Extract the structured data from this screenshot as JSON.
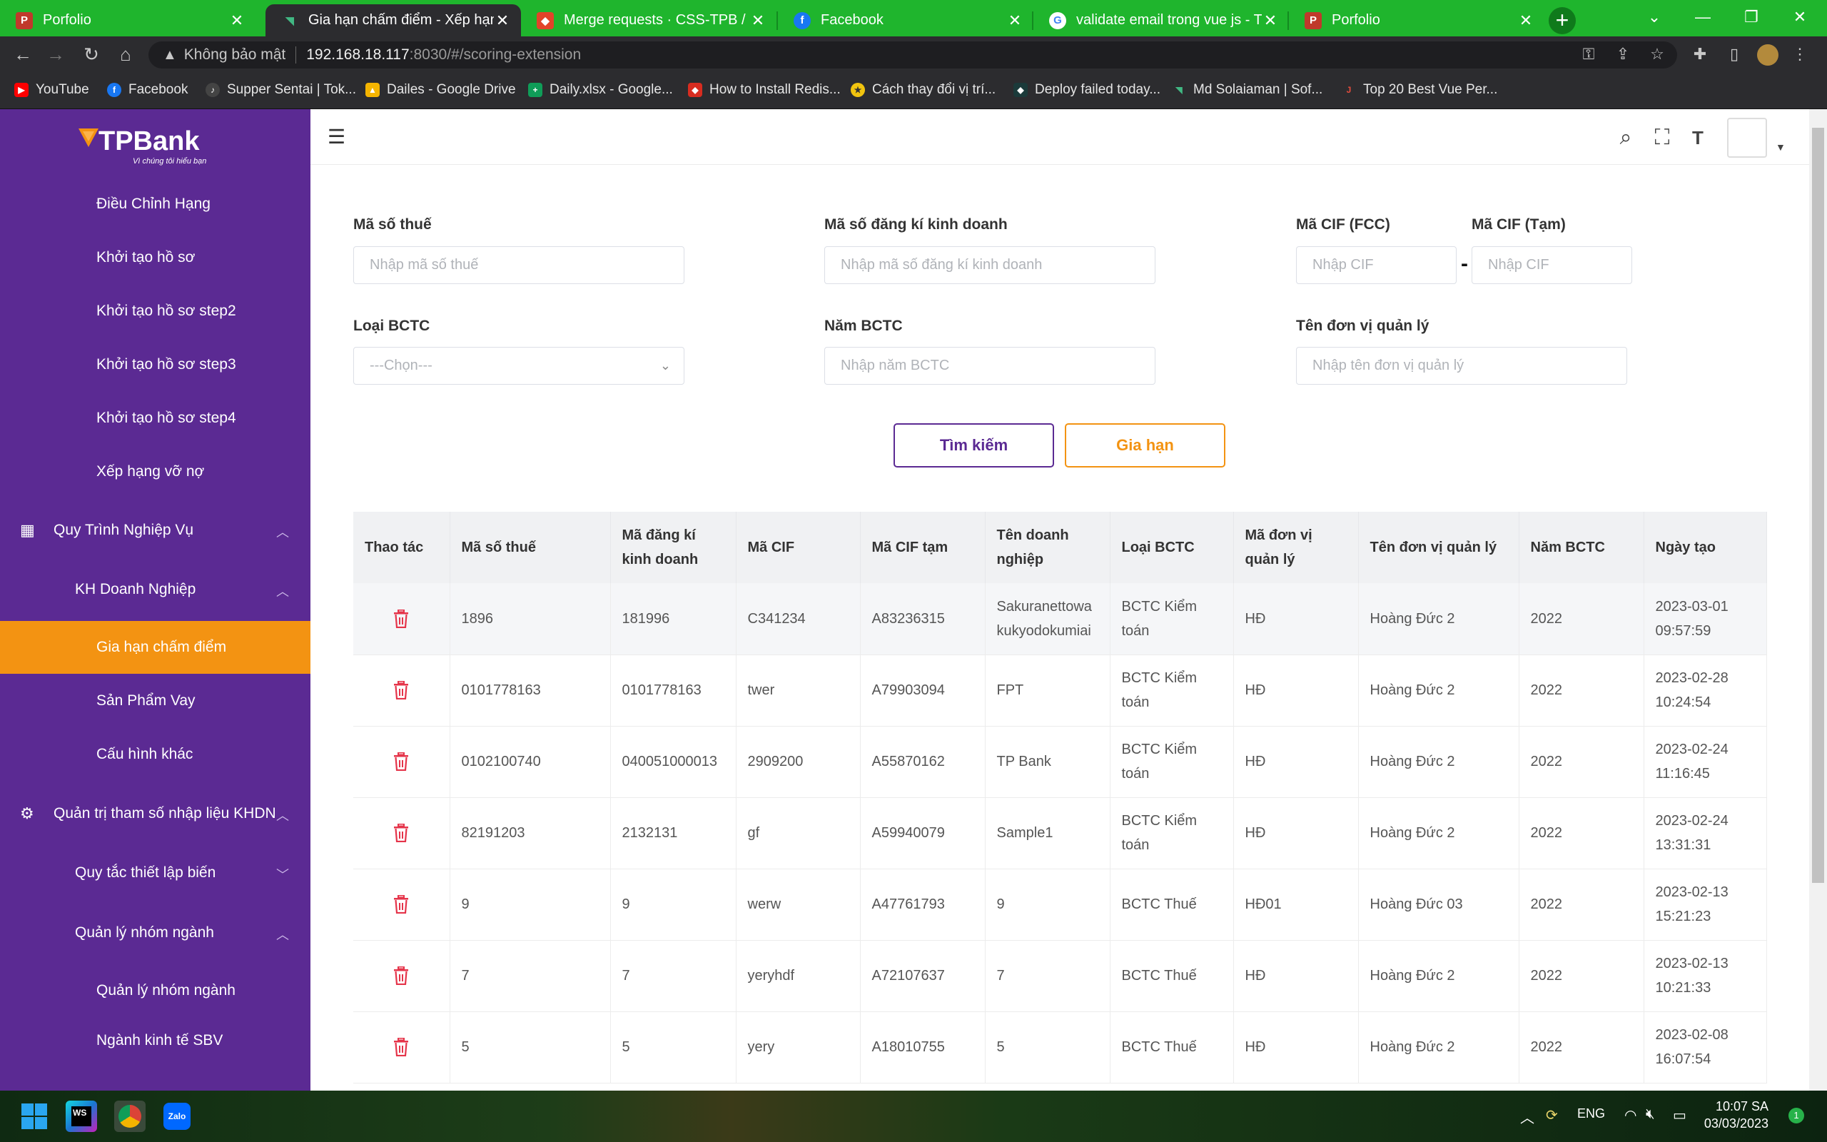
{
  "browser": {
    "tabs": [
      {
        "title": "Porfolio",
        "icon": "document-icon",
        "color": "#c0392b"
      },
      {
        "title": "Gia hạn chấm điểm - Xếp hạng tí",
        "icon": "vue-icon",
        "color": "#41b883",
        "active": true
      },
      {
        "title": "Merge requests · CSS-TPB / CSS-",
        "icon": "gitlab-icon",
        "color": "#e24329"
      },
      {
        "title": "Facebook",
        "icon": "facebook-icon",
        "color": "#1877f2"
      },
      {
        "title": "validate email trong vue js - Tìm",
        "icon": "google-icon",
        "color": "#ffffff"
      },
      {
        "title": "Porfolio",
        "icon": "document-icon",
        "color": "#c0392b"
      }
    ],
    "security_label": "Không bảo mật",
    "url_host": "192.168.18.117",
    "url_path": ":8030/#/scoring-extension",
    "bookmarks": [
      {
        "label": "YouTube",
        "icon": "youtube-icon",
        "color": "#ff0000"
      },
      {
        "label": "Facebook",
        "icon": "facebook-icon",
        "color": "#1877f2"
      },
      {
        "label": "Supper Sentai | Tok...",
        "icon": "tiktok-icon",
        "color": "#222222"
      },
      {
        "label": "Dailes - Google Drive",
        "icon": "drive-icon",
        "color": "#f4b400"
      },
      {
        "label": "Daily.xlsx - Google...",
        "icon": "sheets-icon",
        "color": "#0f9d58"
      },
      {
        "label": "How to Install Redis...",
        "icon": "redis-icon",
        "color": "#d82c20"
      },
      {
        "label": "Cách thay đổi vị trí...",
        "icon": "site-icon",
        "color": "#f1c40f"
      },
      {
        "label": "Deploy failed today...",
        "icon": "deploy-icon",
        "color": "#1b3a3a"
      },
      {
        "label": "Md Solaiaman | Sof...",
        "icon": "vue-icon",
        "color": "#41b883"
      },
      {
        "label": "Top 20 Best Vue Per...",
        "icon": "j-icon",
        "color": "#e74c3c"
      }
    ]
  },
  "sidebar": {
    "brand": "TPBank",
    "tagline": "Vì chúng tôi hiểu bạn",
    "items": [
      {
        "label": "Điều Chỉnh Hạng",
        "level": 2
      },
      {
        "label": "Khởi tạo hồ sơ",
        "level": 2
      },
      {
        "label": "Khởi tạo hồ sơ step2",
        "level": 2
      },
      {
        "label": "Khởi tạo hồ sơ step3",
        "level": 2
      },
      {
        "label": "Khởi tạo hồ sơ step4",
        "level": 2
      },
      {
        "label": "Xếp hạng vỡ nợ",
        "level": 2
      },
      {
        "label": "Quy Trình Nghiệp Vụ",
        "level": 0,
        "icon": "grid-icon",
        "chevron": "up"
      },
      {
        "label": "KH Doanh Nghiệp",
        "level": 1,
        "chevron": "up"
      },
      {
        "label": "Gia hạn chấm điểm",
        "level": 2,
        "active": true
      },
      {
        "label": "Sản Phẩm Vay",
        "level": 2
      },
      {
        "label": "Cấu hình khác",
        "level": 2
      },
      {
        "label": "Quản trị tham số nhập liệu KHDN",
        "level": 0,
        "icon": "settings-icon",
        "chevron": "up"
      },
      {
        "label": "Quy tắc thiết lập biến",
        "level": 1,
        "chevron": "down"
      },
      {
        "label": "Quản lý nhóm ngành",
        "level": 1,
        "chevron": "up"
      },
      {
        "label": "Quản lý nhóm ngành",
        "level": 2
      },
      {
        "label": "Ngành kinh tế SBV",
        "level": 2
      }
    ]
  },
  "form": {
    "tax_code": {
      "label": "Mã số thuế",
      "placeholder": "Nhập mã số thuế"
    },
    "business_reg": {
      "label": "Mã số đăng kí kinh doanh",
      "placeholder": "Nhập mã số đăng kí kinh doanh"
    },
    "cif_fcc": {
      "label": "Mã CIF (FCC)",
      "placeholder": "Nhập CIF"
    },
    "cif_temp": {
      "label": "Mã CIF (Tạm)",
      "placeholder": "Nhập CIF"
    },
    "report_type": {
      "label": "Loại BCTC",
      "value": "---Chọn---"
    },
    "report_year": {
      "label": "Năm BCTC",
      "placeholder": "Nhập năm BCTC"
    },
    "manager_unit": {
      "label": "Tên đơn vị quản lý",
      "placeholder": "Nhập tên đơn vị quản lý"
    },
    "range_dash": "-",
    "search_button": "Tìm kiếm",
    "extend_button": "Gia hạn"
  },
  "table": {
    "headers": [
      "Thao tác",
      "Mã số thuế",
      "Mã đăng kí kinh doanh",
      "Mã CIF",
      "Mã CIF tạm",
      "Tên doanh nghiệp",
      "Loại BCTC",
      "Mã đơn vị quản lý",
      "Tên đơn vị quản lý",
      "Năm BCTC",
      "Ngày tạo"
    ],
    "rows": [
      [
        "1896",
        "181996",
        "C341234",
        "A83236315",
        "Sakuranettowa kukyodokumiai",
        "BCTC Kiểm toán",
        "HĐ",
        "Hoàng Đức 2",
        "2022",
        "2023-03-01 09:57:59"
      ],
      [
        "0101778163",
        "0101778163",
        "twer",
        "A79903094",
        "FPT",
        "BCTC Kiểm toán",
        "HĐ",
        "Hoàng Đức 2",
        "2022",
        "2023-02-28 10:24:54"
      ],
      [
        "0102100740",
        "040051000013",
        "2909200",
        "A55870162",
        "TP Bank",
        "BCTC Kiểm toán",
        "HĐ",
        "Hoàng Đức 2",
        "2022",
        "2023-02-24 11:16:45"
      ],
      [
        "82191203",
        "2132131",
        "gf",
        "A59940079",
        "Sample1",
        "BCTC Kiểm toán",
        "HĐ",
        "Hoàng Đức 2",
        "2022",
        "2023-02-24 13:31:31"
      ],
      [
        "9",
        "9",
        "werw",
        "A47761793",
        "9",
        "BCTC Thuế",
        "HĐ01",
        "Hoàng Đức 03",
        "2022",
        "2023-02-13 15:21:23"
      ],
      [
        "7",
        "7",
        "yeryhdf",
        "A72107637",
        "7",
        "BCTC Thuế",
        "HĐ",
        "Hoàng Đức 2",
        "2022",
        "2023-02-13 10:21:33"
      ],
      [
        "5",
        "5",
        "yery",
        "A18010755",
        "5",
        "BCTC Thuế",
        "HĐ",
        "Hoàng Đức 2",
        "2022",
        "2023-02-08 16:07:54"
      ]
    ],
    "delete_icon": "trash-icon"
  },
  "taskbar": {
    "apps": [
      "windows-start-icon",
      "webstorm-icon",
      "chrome-icon",
      "zalo-icon"
    ],
    "language": "ENG",
    "time": "10:07 SA",
    "date": "03/03/2023",
    "notification_count": "1"
  },
  "colors": {
    "sidebar": "#5b2a93",
    "active": "#f39312",
    "primary": "#5b2a93",
    "chrome_theme": "#1fb52d"
  }
}
